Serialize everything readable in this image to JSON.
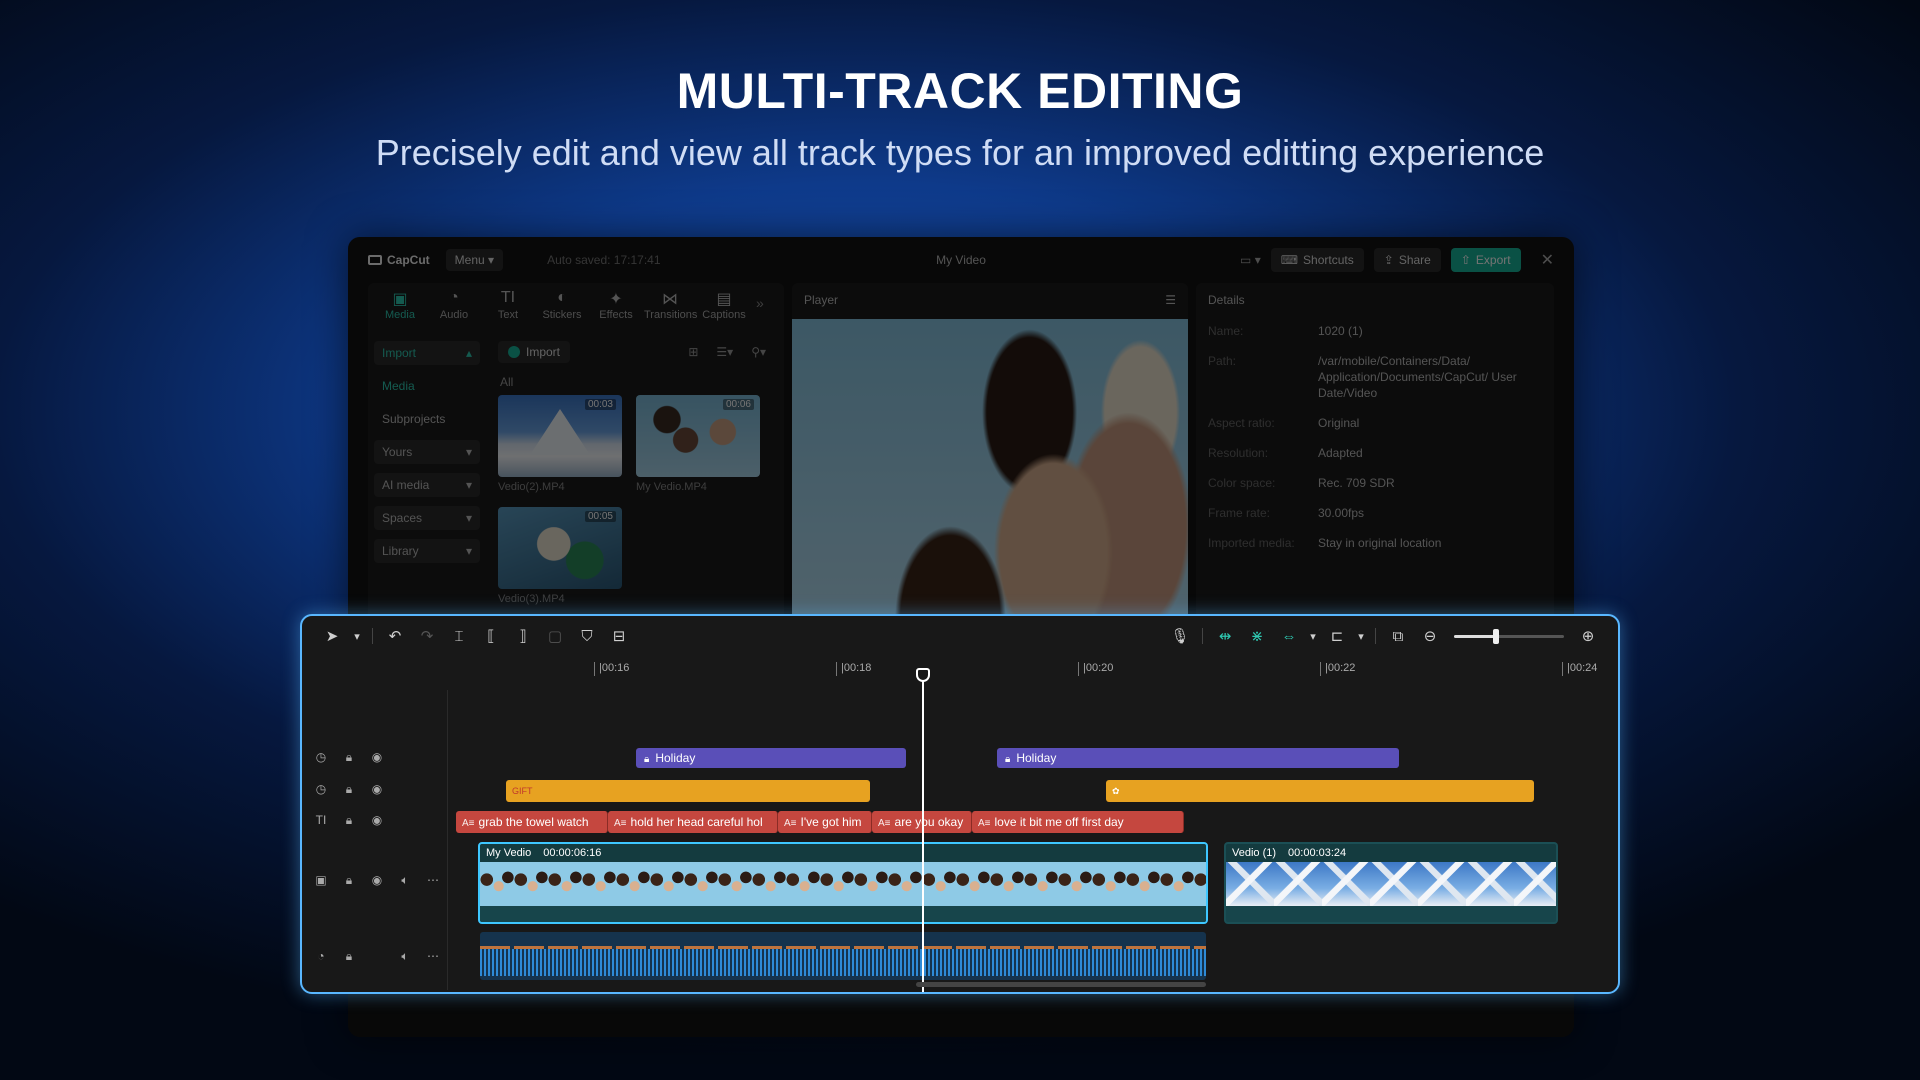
{
  "hero": {
    "title": "MULTI-TRACK EDITING",
    "subtitle": "Precisely edit and view all track types for an improved editting experience"
  },
  "app": {
    "brand": "CapCut",
    "menu_label": "Menu",
    "autosave": "Auto saved: 17:17:41",
    "doc_title": "My Video",
    "shortcuts_label": "Shortcuts",
    "share_label": "Share",
    "export_label": "Export",
    "accent": "#2ec7b0"
  },
  "tools": [
    {
      "label": "Media",
      "icon": "media-icon",
      "glyph": "▣",
      "active": true
    },
    {
      "label": "Audio",
      "icon": "audio-icon",
      "glyph": "◔"
    },
    {
      "label": "Text",
      "icon": "text-icon",
      "glyph": "TI"
    },
    {
      "label": "Stickers",
      "icon": "stickers-icon",
      "glyph": "◐"
    },
    {
      "label": "Effects",
      "icon": "effects-icon",
      "glyph": "✦"
    },
    {
      "label": "Transitions",
      "icon": "transitions-icon",
      "glyph": "⋈"
    },
    {
      "label": "Captions",
      "icon": "captions-icon",
      "glyph": "▤"
    }
  ],
  "sidebar": {
    "import": "Import",
    "media": "Media",
    "subprojects": "Subprojects",
    "yours": "Yours",
    "ai_media": "AI media",
    "spaces": "Spaces",
    "library": "Library"
  },
  "media": {
    "import_label": "Import",
    "filter_all": "All",
    "items": [
      {
        "name": "Vedio(2).MP4",
        "duration": "00:03"
      },
      {
        "name": "My Vedio.MP4",
        "duration": "00:06"
      },
      {
        "name": "Vedio(3).MP4",
        "duration": "00:05"
      }
    ]
  },
  "player": {
    "title": "Player"
  },
  "details": {
    "title": "Details",
    "rows": [
      {
        "key": "Name:",
        "value": "1020 (1)"
      },
      {
        "key": "Path:",
        "value": "/var/mobile/Containers/Data/ Application/Documents/CapCut/ User Date/Video"
      },
      {
        "key": "Aspect ratio:",
        "value": "Original"
      },
      {
        "key": "Resolution:",
        "value": "Adapted"
      },
      {
        "key": "Color space:",
        "value": "Rec. 709 SDR"
      },
      {
        "key": "Frame rate:",
        "value": "30.00fps"
      },
      {
        "key": "Imported media:",
        "value": "Stay in original location"
      }
    ]
  },
  "timeline": {
    "ruler": [
      "|00:16",
      "|00:18",
      "|00:20",
      "|00:22",
      "|00:24"
    ],
    "zoom_level": 0.38,
    "holiday_clips": [
      "Holiday",
      "Holiday"
    ],
    "sticker_label": "GIFT",
    "captions": [
      "grab the towel watch",
      "hold her head careful hol",
      "I've got him",
      "are you okay",
      "love it bit me off first day"
    ],
    "video_clips": [
      {
        "name": "My Vedio",
        "duration": "00:00:06:16"
      },
      {
        "name": "Vedio (1)",
        "duration": "00:00:03:24"
      }
    ],
    "selection_color": "#59b7ff"
  }
}
